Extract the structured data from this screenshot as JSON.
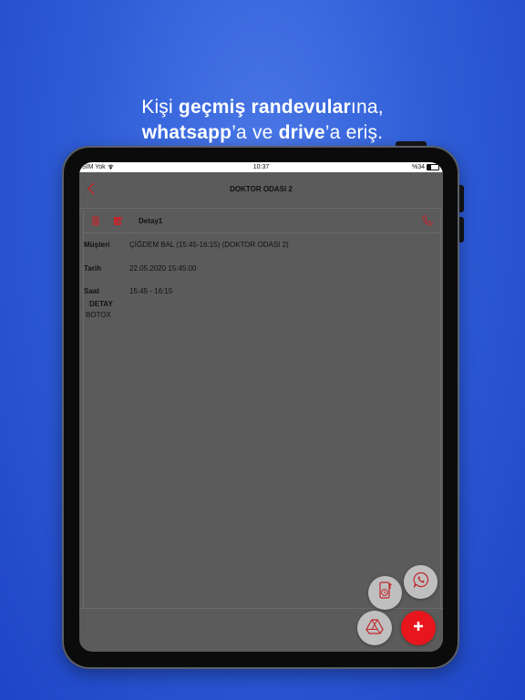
{
  "headline": {
    "line1_a": "Kişi ",
    "line1_b": "geçmiş randevular",
    "line1_c": "ına,",
    "line2_a": "whatsapp",
    "line2_b": "’a ve ",
    "line2_c": "drive",
    "line2_d": "’a eriş."
  },
  "statusbar": {
    "carrier": "SIM Yok",
    "time": "10:37",
    "battery": "%34"
  },
  "navbar": {
    "title": "DOKTOR ODASI 2",
    "back_icon": "chevron-left-icon"
  },
  "toolbar": {
    "title": "Detay1",
    "icons": [
      "trash-icon",
      "edit-icon",
      "phone-icon"
    ]
  },
  "appointment": {
    "customer_label": "Müşteri",
    "customer_value": "ÇİĞDEM BAL (15:45-16:15) (DOKTOR ODASI 2)",
    "date_label": "Tarih",
    "date_value": "22.05.2020 15:45:00",
    "time_label": "Saat",
    "time_value": "15:45 - 16:15",
    "detail_label": "DETAY",
    "detail_value": "BOTOX"
  },
  "fab": {
    "buttons": [
      "whatsapp-icon",
      "history-icon",
      "drive-icon",
      "plus-icon"
    ]
  },
  "colors": {
    "background": "#2f5ed8",
    "accent_red": "#e8161c",
    "screen_overlay": "#5b5b5b"
  }
}
